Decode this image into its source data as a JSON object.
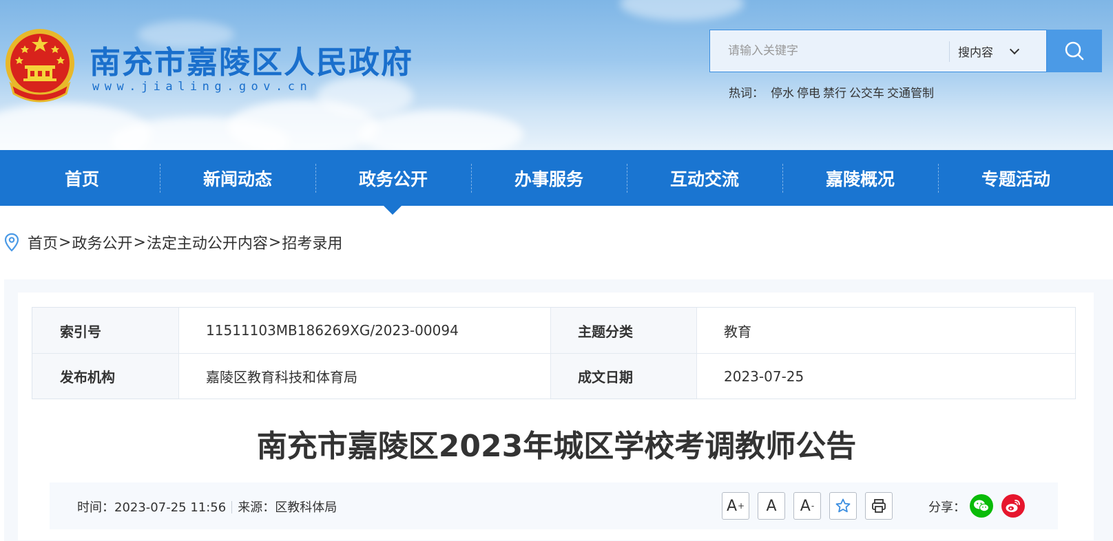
{
  "header": {
    "site_title": "南充市嘉陵区人民政府",
    "site_url": "www.jialing.gov.cn",
    "search": {
      "placeholder": "请输入关键字",
      "scope": "搜内容"
    },
    "hot_label": "热词：",
    "hot_words": [
      "停水",
      "停电",
      "禁行",
      "公交车",
      "交通管制"
    ]
  },
  "nav": {
    "items": [
      "首页",
      "新闻动态",
      "政务公开",
      "办事服务",
      "互动交流",
      "嘉陵概况",
      "专题活动"
    ],
    "active_index": 2
  },
  "breadcrumb": [
    "首页",
    "政务公开",
    "法定主动公开内容",
    "招考录用"
  ],
  "breadcrumb_sep": ">",
  "meta": {
    "index_label": "索引号",
    "index_value": "11511103MB186269XG/2023-00094",
    "topic_label": "主题分类",
    "topic_value": "教育",
    "org_label": "发布机构",
    "org_value": "嘉陵区教育科技和体育局",
    "date_label": "成文日期",
    "date_value": "2023-07-25"
  },
  "article": {
    "title": "南充市嘉陵区2023年城区学校考调教师公告",
    "time_label": "时间：",
    "time_value": "2023-07-25 11:56",
    "source_label": "来源：",
    "source_value": "区教科体局",
    "share_label": "分享："
  },
  "toolbar": {
    "font_larger": "A",
    "font_normal": "A",
    "font_smaller": "A",
    "sup_plus": "+",
    "sup_minus": "-"
  },
  "colors": {
    "brand_blue": "#1a75d1",
    "title_blue": "#1a6fcc",
    "wechat_green": "#09bb07",
    "weibo_red": "#e6162d"
  }
}
